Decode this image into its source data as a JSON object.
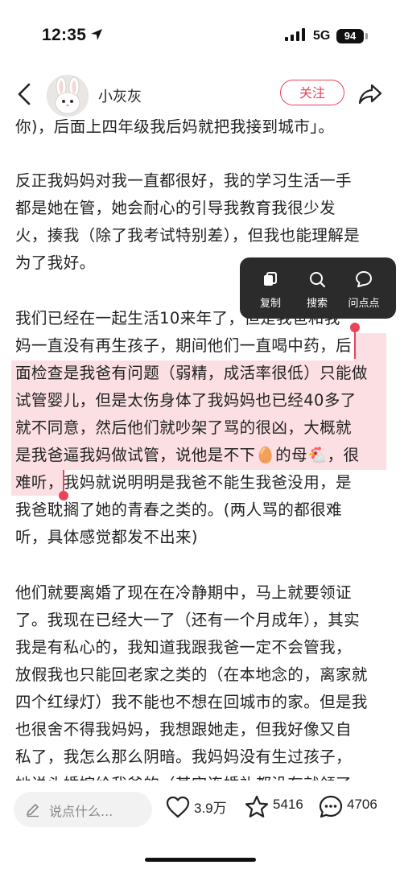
{
  "status_bar": {
    "time": "12:35",
    "network": "5G",
    "battery": "94"
  },
  "nav": {
    "username": "小灰灰",
    "follow_label": "关注"
  },
  "content_lines": [
    "你)，后面上四年级我后妈就把我接到城市」。",
    "",
    "反正我妈妈对我一直都很好，我的学习生活一手",
    "都是她在管，她会耐心的引导我教育我很少发",
    "火，揍我（除了我考试特别差），但我也能理解是",
    "为了我好。",
    "",
    "我们已经在一起生活10来年了，但是我爸和我",
    "妈一直没有再生孩子，期间他们一直喝中药，后",
    "面检查是我爸有问题（弱精，成活率很低）只能做",
    "试管婴儿，但是太伤身体了我妈妈也已经40多了",
    "就不同意，然后他们就吵架了骂的很凶，大概就",
    "是我爸逼我妈做试管，说他是不下🥚的母🐔，很",
    "难听，我妈就说明明是我爸不能生我爸没用，是",
    "我爸耽搁了她的青春之类的。(两人骂的都很难",
    "听，具体感觉都发不出来)",
    "",
    "他们就要离婚了现在在冷静期中，马上就要领证",
    "了。我现在已经大一了（还有一个月成年），其实",
    "我是有私心的，我知道我跟我爸一定不会管我，",
    "放假我也只能回老家之类的（在本地念的，离家就",
    "四个红绿灯）我不能也不想在回城市的家。但是我",
    "也很舍不得我妈妈，我想跟她走，但我好像又自",
    "私了，我怎么那么阴暗。我妈妈没有生过孩子，",
    "她说头婚嫁给我爸的（甚实连婚礼都没有就领了"
  ],
  "context_menu": {
    "copy": "复制",
    "search": "搜索",
    "ask": "问点点"
  },
  "bottom_bar": {
    "comment_placeholder": "说点什么...",
    "likes": "3.9万",
    "favorites": "5416",
    "comments": "4706"
  },
  "colors": {
    "accent": "#e8445a",
    "highlight": "#fbdfe3",
    "menu_bg": "#2b2b2b"
  }
}
